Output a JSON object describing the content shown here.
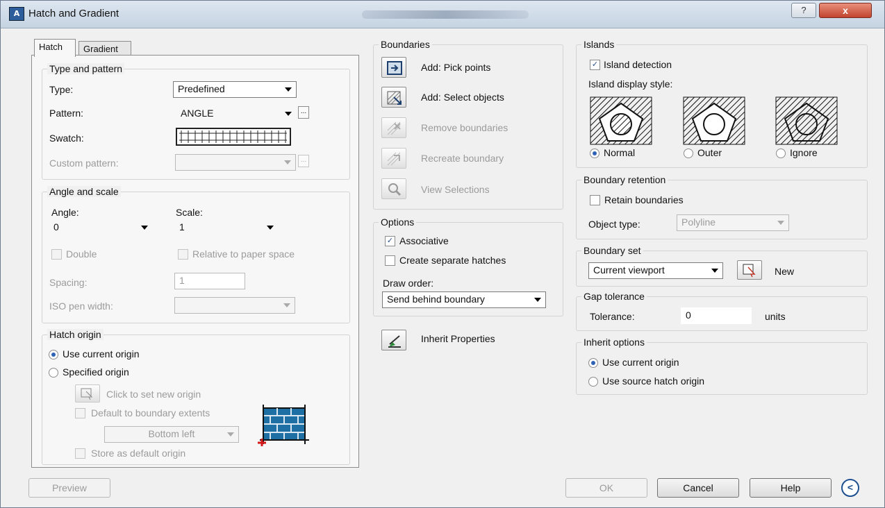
{
  "window": {
    "title": "Hatch and Gradient",
    "help_glyph": "?",
    "close_glyph": "x"
  },
  "tabs": {
    "hatch": "Hatch",
    "gradient": "Gradient"
  },
  "type_pattern": {
    "title": "Type and pattern",
    "type_label": "Type:",
    "type_value": "Predefined",
    "pattern_label": "Pattern:",
    "pattern_value": "ANGLE",
    "swatch_label": "Swatch:",
    "custom_label": "Custom pattern:",
    "custom_value": ""
  },
  "angle_scale": {
    "title": "Angle and scale",
    "angle_label": "Angle:",
    "angle_value": "0",
    "scale_label": "Scale:",
    "scale_value": "1",
    "double_label": "Double",
    "relative_label": "Relative to paper space",
    "spacing_label": "Spacing:",
    "spacing_value": "1",
    "iso_label": "ISO pen width:",
    "iso_value": ""
  },
  "hatch_origin": {
    "title": "Hatch origin",
    "use_current": "Use current origin",
    "specified": "Specified origin",
    "click_set": "Click to set new origin",
    "default_extents": "Default to boundary extents",
    "extent_value": "Bottom left",
    "store_default": "Store as default origin"
  },
  "boundaries": {
    "title": "Boundaries",
    "add_pick": "Add: Pick points",
    "add_select": "Add: Select objects",
    "remove": "Remove boundaries",
    "recreate": "Recreate boundary",
    "view": "View Selections"
  },
  "options": {
    "title": "Options",
    "associative": "Associative",
    "associative_checked": true,
    "separate": "Create separate hatches",
    "draw_order_label": "Draw order:",
    "draw_order_value": "Send behind boundary"
  },
  "inherit": {
    "label": "Inherit Properties"
  },
  "islands": {
    "title": "Islands",
    "detection": "Island detection",
    "detection_checked": true,
    "display_style": "Island display style:",
    "normal": "Normal",
    "outer": "Outer",
    "ignore": "Ignore",
    "selected": "normal"
  },
  "boundary_retention": {
    "title": "Boundary retention",
    "retain": "Retain boundaries",
    "object_type_label": "Object type:",
    "object_type_value": "Polyline"
  },
  "boundary_set": {
    "title": "Boundary set",
    "value": "Current viewport",
    "new_label": "New"
  },
  "gap_tolerance": {
    "title": "Gap tolerance",
    "label": "Tolerance:",
    "value": "0",
    "units": "units"
  },
  "inherit_options": {
    "title": "Inherit options",
    "use_current": "Use current origin",
    "use_source": "Use source hatch origin"
  },
  "footer": {
    "preview": "Preview",
    "ok": "OK",
    "cancel": "Cancel",
    "help": "Help",
    "collapse_glyph": "<"
  },
  "colors": {
    "accent": "#2e62b5",
    "title_bg": "#c5d3e2",
    "close_bg": "#c1442f",
    "disabled_text": "#9b9b9b"
  }
}
